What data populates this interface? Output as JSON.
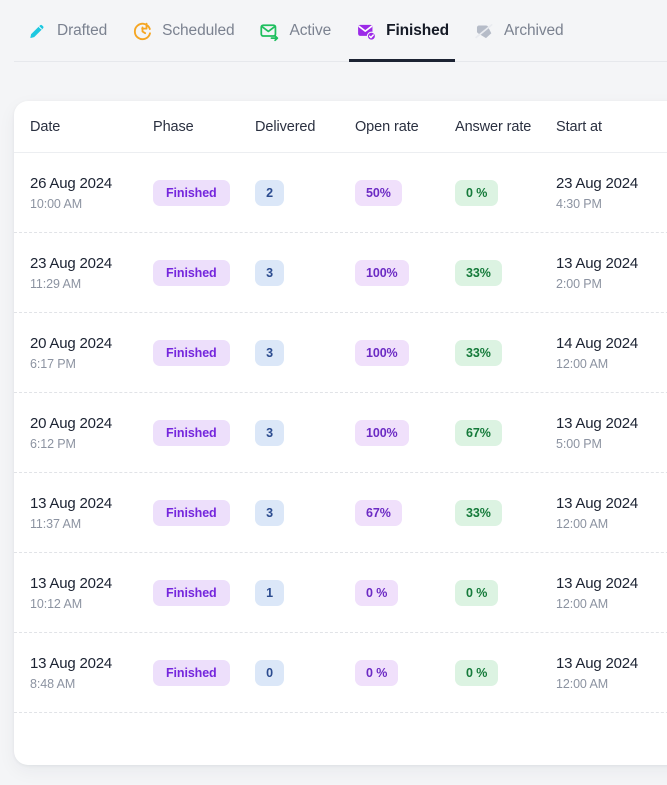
{
  "tabs": [
    {
      "label": "Drafted",
      "icon": "pencil-icon",
      "active": false,
      "color": "#1ec8e0"
    },
    {
      "label": "Scheduled",
      "icon": "clock-arrow-icon",
      "active": false,
      "color": "#f5a623"
    },
    {
      "label": "Active",
      "icon": "envelope-arrow-icon",
      "active": false,
      "color": "#1fbf5e"
    },
    {
      "label": "Finished",
      "icon": "envelope-check-icon",
      "active": true,
      "color": "#9c2ae8"
    },
    {
      "label": "Archived",
      "icon": "archive-tag-icon",
      "active": false,
      "color": "#b6bcc8"
    }
  ],
  "table": {
    "columns": [
      "Date",
      "Phase",
      "Delivered",
      "Open rate",
      "Answer rate",
      "Start at"
    ],
    "rows": [
      {
        "date": "26 Aug 2024",
        "time": "10:00 AM",
        "phase": "Finished",
        "delivered": "2",
        "open_rate": "50%",
        "answer_rate": "0 %",
        "start_date": "23 Aug 2024",
        "start_time": "4:30 PM"
      },
      {
        "date": "23 Aug 2024",
        "time": "11:29 AM",
        "phase": "Finished",
        "delivered": "3",
        "open_rate": "100%",
        "answer_rate": "33%",
        "start_date": "13 Aug 2024",
        "start_time": "2:00 PM"
      },
      {
        "date": "20 Aug 2024",
        "time": "6:17 PM",
        "phase": "Finished",
        "delivered": "3",
        "open_rate": "100%",
        "answer_rate": "33%",
        "start_date": "14 Aug 2024",
        "start_time": "12:00 AM"
      },
      {
        "date": "20 Aug 2024",
        "time": "6:12 PM",
        "phase": "Finished",
        "delivered": "3",
        "open_rate": "100%",
        "answer_rate": "67%",
        "start_date": "13 Aug 2024",
        "start_time": "5:00 PM"
      },
      {
        "date": "13 Aug 2024",
        "time": "11:37 AM",
        "phase": "Finished",
        "delivered": "3",
        "open_rate": "67%",
        "answer_rate": "33%",
        "start_date": "13 Aug 2024",
        "start_time": "12:00 AM"
      },
      {
        "date": "13 Aug 2024",
        "time": "10:12 AM",
        "phase": "Finished",
        "delivered": "1",
        "open_rate": "0 %",
        "answer_rate": "0 %",
        "start_date": "13 Aug 2024",
        "start_time": "12:00 AM"
      },
      {
        "date": "13 Aug 2024",
        "time": "8:48 AM",
        "phase": "Finished",
        "delivered": "0",
        "open_rate": "0 %",
        "answer_rate": "0 %",
        "start_date": "13 Aug 2024",
        "start_time": "12:00 AM"
      }
    ]
  },
  "colors": {
    "page_background": "#f4f5f7",
    "card_background": "#ffffff",
    "active_tab_underline": "#1c2333",
    "phase_badge_bg": "#eddffb",
    "phase_badge_fg": "#7526dd",
    "delivered_badge_bg": "#dbe7f8",
    "delivered_badge_fg": "#2b4b8f",
    "open_badge_bg": "#f0e0fb",
    "open_badge_fg": "#6c2bc4",
    "answer_badge_bg": "#dcf3e2",
    "answer_badge_fg": "#157a3a"
  }
}
